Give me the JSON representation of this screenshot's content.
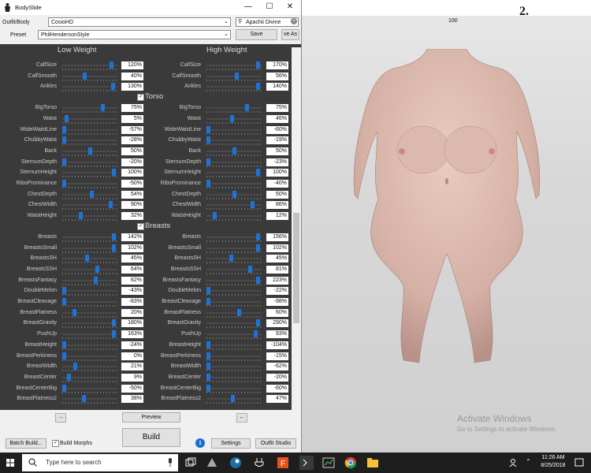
{
  "window": {
    "title": "BodySlide"
  },
  "outfit": {
    "label": "Outfit/Body",
    "value": "CosioHD",
    "filter": "Apachii Divine"
  },
  "preset": {
    "label": "Preset",
    "value": "PhilHendersonStyle",
    "save": "Save",
    "save_as": "ve As"
  },
  "columns": {
    "low": "Low Weight",
    "high": "High Weight"
  },
  "categories": {
    "torso": "Torso",
    "breasts": "Breasts"
  },
  "sliders_top": [
    {
      "name": "CalfSize",
      "low": "120%",
      "high": "170%",
      "lp": 0.93,
      "hp": 0.97
    },
    {
      "name": "CalfSmooth",
      "low": "40%",
      "high": "56%",
      "lp": 0.4,
      "hp": 0.55
    },
    {
      "name": "Ankles",
      "low": "130%",
      "high": "140%",
      "lp": 0.95,
      "hp": 0.97
    }
  ],
  "sliders_torso": [
    {
      "name": "BigTorso",
      "low": "75%",
      "high": "75%",
      "lp": 0.75,
      "hp": 0.75
    },
    {
      "name": "Waist",
      "low": "5%",
      "high": "46%",
      "lp": 0.05,
      "hp": 0.46
    },
    {
      "name": "WideWaistLine",
      "low": "-57%",
      "high": "-60%",
      "lp": 0.0,
      "hp": 0.0
    },
    {
      "name": "ChubbyWaist",
      "low": "-28%",
      "high": "-19%",
      "lp": 0.0,
      "hp": 0.0
    },
    {
      "name": "Back",
      "low": "50%",
      "high": "50%",
      "lp": 0.5,
      "hp": 0.5
    },
    {
      "name": "SternumDepth",
      "low": "-20%",
      "high": "-23%",
      "lp": 0.0,
      "hp": 0.0
    },
    {
      "name": "SternumHeight",
      "low": "100%",
      "high": "100%",
      "lp": 0.97,
      "hp": 0.97
    },
    {
      "name": "RibsProminance",
      "low": "-50%",
      "high": "-40%",
      "lp": 0.0,
      "hp": 0.0
    },
    {
      "name": "ChestDepth",
      "low": "54%",
      "high": "50%",
      "lp": 0.54,
      "hp": 0.5
    },
    {
      "name": "ChestWidth",
      "low": "90%",
      "high": "86%",
      "lp": 0.9,
      "hp": 0.86
    },
    {
      "name": "WaistHeight",
      "low": "32%",
      "high": "12%",
      "lp": 0.32,
      "hp": 0.12
    }
  ],
  "sliders_breasts": [
    {
      "name": "Breasts",
      "low": "142%",
      "high": "156%",
      "lp": 0.97,
      "hp": 0.97
    },
    {
      "name": "BreastsSmall",
      "low": "102%",
      "high": "102%",
      "lp": 0.97,
      "hp": 0.97
    },
    {
      "name": "BreastsSH",
      "low": "45%",
      "high": "45%",
      "lp": 0.45,
      "hp": 0.45
    },
    {
      "name": "BreastsSSH",
      "low": "64%",
      "high": "81%",
      "lp": 0.64,
      "hp": 0.81
    },
    {
      "name": "BreastsFantasy",
      "low": "62%",
      "high": "223%",
      "lp": 0.62,
      "hp": 0.97
    },
    {
      "name": "DoubleMelon",
      "low": "-43%",
      "high": "-22%",
      "lp": 0.0,
      "hp": 0.0
    },
    {
      "name": "BreastCleavage",
      "low": "-83%",
      "high": "-98%",
      "lp": 0.0,
      "hp": 0.0
    },
    {
      "name": "BreastFlatness",
      "low": "20%",
      "high": "60%",
      "lp": 0.2,
      "hp": 0.6
    },
    {
      "name": "BreastGravity",
      "low": "180%",
      "high": "290%",
      "lp": 0.97,
      "hp": 0.97
    },
    {
      "name": "PushUp",
      "low": "163%",
      "high": "93%",
      "lp": 0.97,
      "hp": 0.93
    },
    {
      "name": "BreastHeight",
      "low": "-24%",
      "high": "-104%",
      "lp": 0.0,
      "hp": 0.0
    },
    {
      "name": "BreastPerkiness",
      "low": "0%",
      "high": "-15%",
      "lp": 0.0,
      "hp": 0.0
    },
    {
      "name": "BreastWidth",
      "low": "21%",
      "high": "-62%",
      "lp": 0.21,
      "hp": 0.0
    },
    {
      "name": "BreastCenter",
      "low": "9%",
      "high": "-20%",
      "lp": 0.09,
      "hp": 0.0
    },
    {
      "name": "BreastCenterBig",
      "low": "-50%",
      "high": "-60%",
      "lp": 0.0,
      "hp": 0.0
    },
    {
      "name": "BreastFlatness2",
      "low": "38%",
      "high": "47%",
      "lp": 0.38,
      "hp": 0.47
    }
  ],
  "bottom": {
    "preview": "Preview",
    "build": "Build",
    "batch_build": "Batch Build...",
    "build_morphs": "Build Morphs",
    "settings": "Settings",
    "outfit_studio": "Outfit Studio",
    "arrow_left": "→",
    "arrow_right": "←",
    "info": "i"
  },
  "preview": {
    "label": "100",
    "corner_number": "2."
  },
  "watermark": {
    "title": "Activate Windows",
    "subtitle": "Go to Settings to activate Windows."
  },
  "taskbar": {
    "search_placeholder": "Type here to search",
    "time": "11:26 AM",
    "date": "8/25/2018"
  }
}
